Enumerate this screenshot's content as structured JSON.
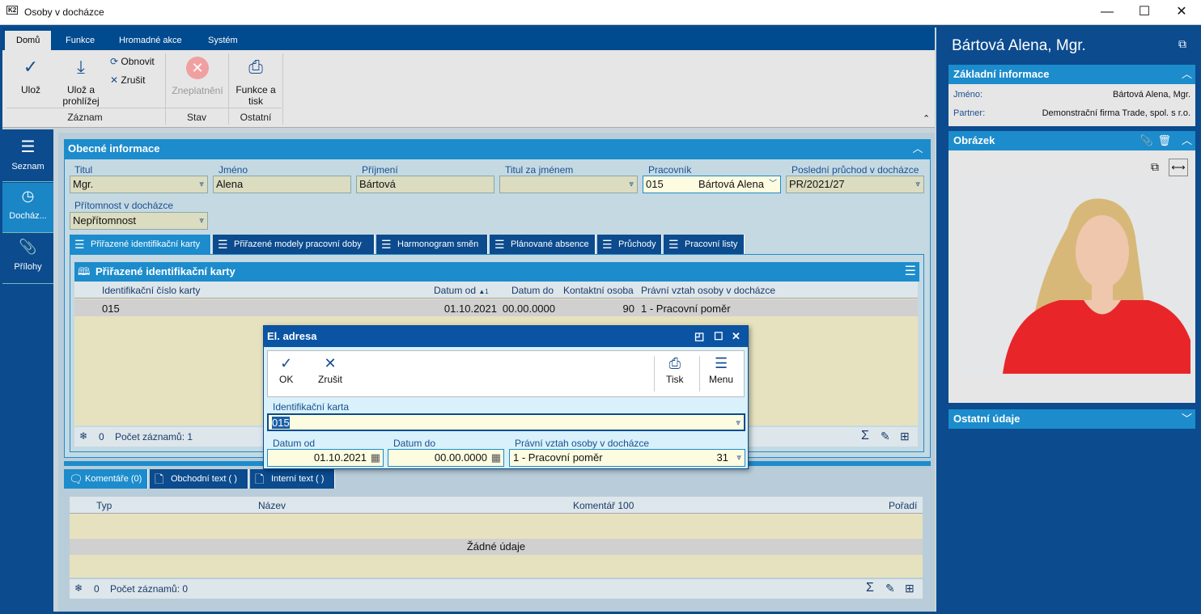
{
  "window": {
    "title": "Osoby v docházce",
    "logo": "K2",
    "minimize": "—",
    "maximize": "☐",
    "close": "✕"
  },
  "ribbon": {
    "tabs": [
      "Domů",
      "Funkce",
      "Hromadné akce",
      "Systém"
    ],
    "buttons": {
      "save": "Ulož",
      "save_browse_1": "Ulož a",
      "save_browse_2": "prohlížej",
      "refresh": "Obnovit",
      "cancel": "Zrušit",
      "invalidate": "Zneplatnění",
      "print_1": "Funkce a",
      "print_2": "tisk"
    },
    "groups": [
      "Záznam",
      "Stav",
      "Ostatní"
    ]
  },
  "sidebar": [
    {
      "label": "Seznam",
      "icon": "menu-icon"
    },
    {
      "label": "Docház...",
      "icon": "clock-icon"
    },
    {
      "label": "Přílohy",
      "icon": "paperclip-icon"
    }
  ],
  "general": {
    "title": "Obecné informace",
    "fields": {
      "titul_label": "Titul",
      "titul": "Mgr.",
      "jmeno_label": "Jméno",
      "jmeno": "Alena",
      "prijmeni_label": "Příjmení",
      "prijmeni": "Bártová",
      "titul_za_label": "Titul za jménem",
      "titul_za": "",
      "pracovnik_label": "Pracovník",
      "pracovnik_code": "015",
      "pracovnik_name": "Bártová Alena",
      "posledni_label": "Poslední průchod v docházce",
      "posledni": "PR/2021/27",
      "pritomnost_label": "Přítomnost v docházce",
      "pritomnost": "Nepřítomnost"
    }
  },
  "tabs": [
    "Přiřazené identifikační karty",
    "Přiřazené modely pracovní doby",
    "Harmonogram směn",
    "Plánované absence",
    "Průchody",
    "Pracovní listy"
  ],
  "cards": {
    "title": "Přiřazené identifikační karty",
    "columns": [
      "Identifikační číslo karty",
      "Datum od",
      "Datum do",
      "Kontaktní osoba",
      "Právní vztah osoby v docházce"
    ],
    "sort_indicator": "▲1",
    "rows": [
      [
        "015",
        "01.10.2021",
        "00.00.0000",
        "90",
        "1 - Pracovní poměr"
      ]
    ],
    "footer_count": "0",
    "footer_text": "Počet záznamů: 1"
  },
  "dialog": {
    "title": "El. adresa",
    "ok": "OK",
    "cancel": "Zrušit",
    "print": "Tisk",
    "menu": "Menu",
    "card_label": "Identifikační karta",
    "card": "015",
    "from_label": "Datum od",
    "from": "01.10.2021",
    "to_label": "Datum do",
    "to": "00.00.0000",
    "rel_label": "Právní vztah osoby v docházce",
    "rel": "1 - Pracovní poměr",
    "rel_code": "31"
  },
  "bottom": {
    "tabs": [
      "Komentáře (0)",
      "Obchodní text ( )",
      "Interní text ( )"
    ],
    "columns": [
      "Typ",
      "Název",
      "Komentář 100",
      "Pořadí"
    ],
    "empty": "Žádné údaje",
    "footer_count": "0",
    "footer_text": "Počet záznamů: 0"
  },
  "right": {
    "name": "Bártová Alena, Mgr.",
    "basic_title": "Základní informace",
    "jmeno_label": "Jméno:",
    "jmeno": "Bártová Alena, Mgr.",
    "partner_label": "Partner:",
    "partner": "Demonstrační firma Trade, spol. s r.o.",
    "image_title": "Obrázek",
    "other_title": "Ostatní údaje"
  }
}
